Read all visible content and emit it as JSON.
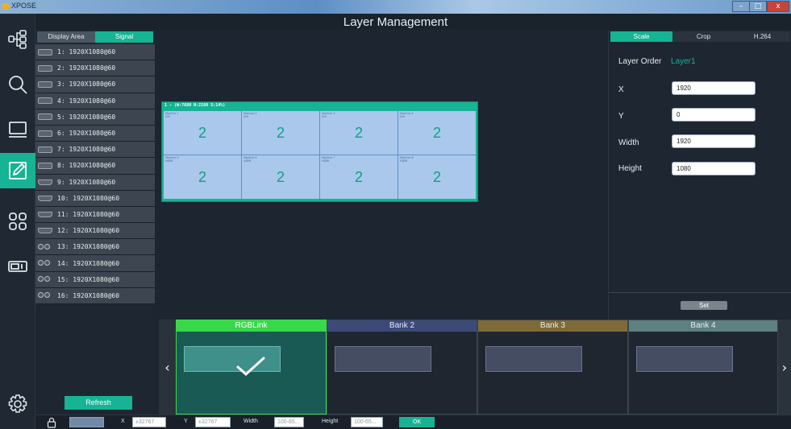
{
  "window": {
    "app_name": "XPOSE",
    "minimize": "–",
    "maximize": "□",
    "close": "x"
  },
  "header": {
    "title": "Layer Management"
  },
  "rail": {
    "items": [
      {
        "icon": "hierarchy-icon",
        "active": false
      },
      {
        "icon": "search-icon",
        "active": false
      },
      {
        "icon": "monitor-icon",
        "active": false
      },
      {
        "icon": "edit-icon",
        "active": true
      },
      {
        "icon": "grid-icon",
        "active": false
      },
      {
        "icon": "device-icon",
        "active": false
      },
      {
        "icon": "gear-icon",
        "active": false
      }
    ]
  },
  "signal_panel": {
    "tabs": {
      "display_area": "Display Area",
      "signal": "Signal"
    },
    "signals": [
      {
        "label": "1: 1920X1080@60",
        "type": "vga"
      },
      {
        "label": "2: 1920X1080@60",
        "type": "vga"
      },
      {
        "label": "3: 1920X1080@60",
        "type": "vga"
      },
      {
        "label": "4: 1920X1080@60",
        "type": "vga"
      },
      {
        "label": "5: 1920X1080@60",
        "type": "dvi"
      },
      {
        "label": "6: 1920X1080@60",
        "type": "dvi"
      },
      {
        "label": "7: 1920X1080@60",
        "type": "dvi"
      },
      {
        "label": "8: 1920X1080@60",
        "type": "dvi"
      },
      {
        "label": "9: 1920X1080@60",
        "type": "hdmi"
      },
      {
        "label": "10: 1920X1080@60",
        "type": "hdmi"
      },
      {
        "label": "11: 1920X1080@60",
        "type": "hdmi"
      },
      {
        "label": "12: 1920X1080@60",
        "type": "hdmi"
      },
      {
        "label": "13: 1920X1080@60",
        "type": "sdi"
      },
      {
        "label": "14: 1920X1080@60",
        "type": "sdi"
      },
      {
        "label": "15: 1920X1080@60",
        "type": "sdi"
      },
      {
        "label": "16: 1920X1080@60",
        "type": "sdi"
      }
    ],
    "refresh": "Refresh"
  },
  "canvas": {
    "screen_label": "1 - (W:7680 H:2160 S:14%)",
    "monitors": [
      {
        "name": "Monitor 1",
        "sub": "DVI",
        "number": "2"
      },
      {
        "name": "Monitor 2",
        "sub": "DVI",
        "number": "2"
      },
      {
        "name": "Monitor 3",
        "sub": "DVI",
        "number": "2"
      },
      {
        "name": "Monitor 4",
        "sub": "DVI",
        "number": "2"
      },
      {
        "name": "Monitor 5",
        "sub": "HDMI",
        "number": "2"
      },
      {
        "name": "Monitor 6",
        "sub": "HDMI",
        "number": "2"
      },
      {
        "name": "Monitor 7",
        "sub": "HDMI",
        "number": "2"
      },
      {
        "name": "Monitor 8",
        "sub": "HDMI",
        "number": "2"
      }
    ]
  },
  "properties": {
    "tabs": {
      "scale": "Scale",
      "crop": "Crop",
      "h264": "H.264"
    },
    "layer_order_label": "Layer Order",
    "layer_order_value": "Layer1",
    "x_label": "X",
    "x_value": "1920",
    "y_label": "Y",
    "y_value": "0",
    "width_label": "Width",
    "width_value": "1920",
    "height_label": "Height",
    "height_value": "1080",
    "set": "Set"
  },
  "banks": {
    "prev": "‹",
    "next": "›",
    "items": [
      {
        "title": "RGBLink",
        "active": true
      },
      {
        "title": "Bank 2",
        "active": false
      },
      {
        "title": "Bank 3",
        "active": false
      },
      {
        "title": "Bank 4",
        "active": false
      }
    ]
  },
  "statusbar": {
    "x_label": "X",
    "x_placeholder": "±32767",
    "y_label": "Y",
    "y_placeholder": "±32767",
    "width_label": "Width",
    "width_placeholder": "100-65...",
    "height_label": "Height",
    "height_placeholder": "100-65...",
    "ok": "OK"
  },
  "colors": {
    "accent": "#16b394",
    "active_bank": "#37d84a",
    "bank2": "#3c4a7a",
    "bank3": "#7e6a38",
    "bank4": "#5d8080"
  }
}
